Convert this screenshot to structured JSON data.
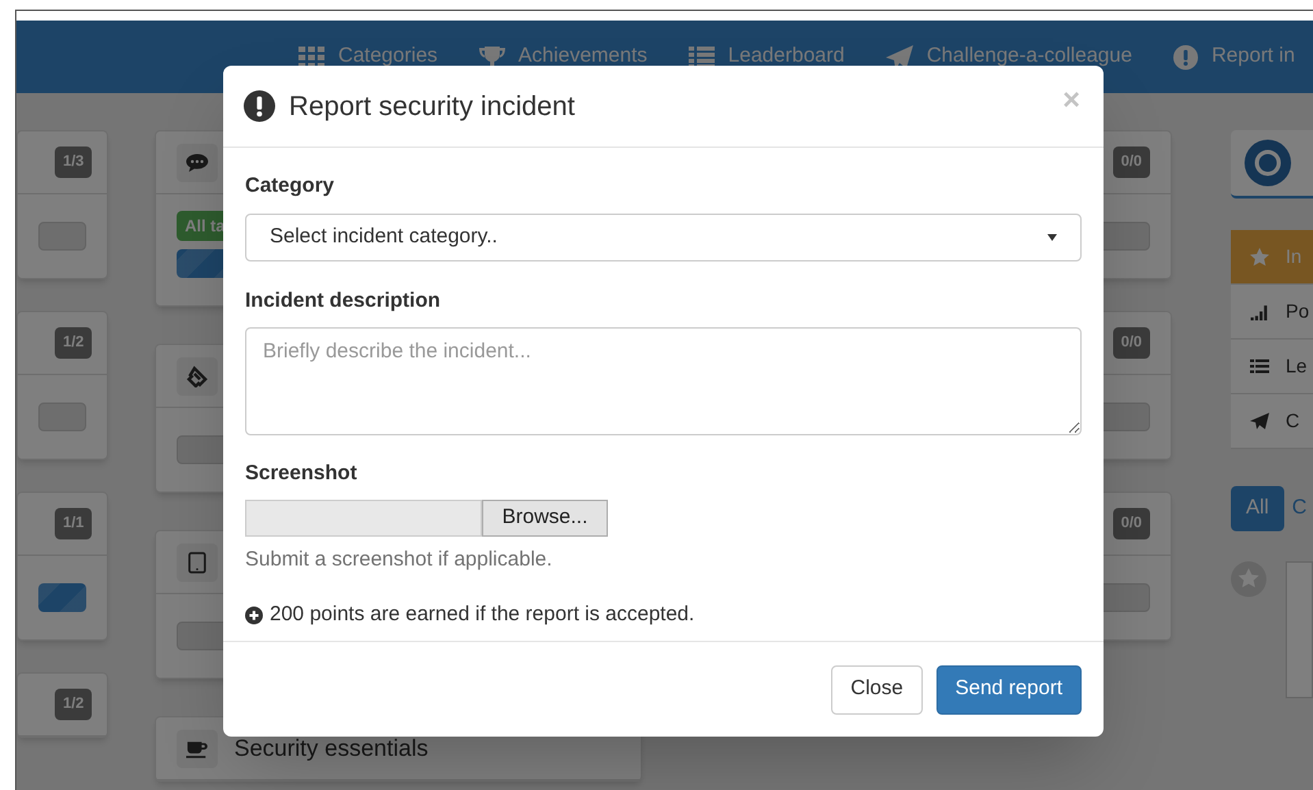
{
  "navbar": {
    "items": [
      {
        "label": "Categories"
      },
      {
        "label": "Achievements"
      },
      {
        "label": "Leaderboard"
      },
      {
        "label": "Challenge-a-colleague"
      },
      {
        "label": "Report in"
      }
    ]
  },
  "columns": [
    {
      "cards": [
        {
          "badge": "1/3",
          "filled": false
        },
        {
          "badge": "1/2",
          "filled": false
        },
        {
          "badge": "1/1",
          "filled": true
        },
        {
          "badge": "1/2"
        }
      ]
    },
    {
      "cards": [
        {
          "tag": "All ta",
          "filled": true
        },
        {
          "filled": false
        },
        {
          "filled": false
        },
        {
          "title": "Security essentials"
        }
      ]
    },
    {
      "cards": [
        {
          "badge": "0/0",
          "filled": false
        },
        {
          "badge": "0/0",
          "filled": false
        },
        {
          "badge": "0/0",
          "filled": false
        }
      ]
    }
  ],
  "sidebar": {
    "menu": [
      {
        "label": "In",
        "selected": true
      },
      {
        "label": "Po",
        "selected": false
      },
      {
        "label": "Le",
        "selected": false
      },
      {
        "label": "C",
        "selected": false
      }
    ],
    "filters": [
      {
        "label": "All",
        "selected": true
      },
      {
        "label": "C",
        "selected": false
      }
    ]
  },
  "modal": {
    "title": "Report security incident",
    "close": "×",
    "category": {
      "label": "Category",
      "value": "Select incident category.."
    },
    "description": {
      "label": "Incident description",
      "placeholder": "Briefly describe the incident..."
    },
    "screenshot": {
      "label": "Screenshot",
      "button": "Browse...",
      "help": "Submit a screenshot if applicable."
    },
    "note": "200 points are earned if the report is accepted.",
    "buttons": [
      {
        "label": "Close",
        "kind": "default"
      },
      {
        "label": "Send report",
        "kind": "primary"
      }
    ]
  }
}
